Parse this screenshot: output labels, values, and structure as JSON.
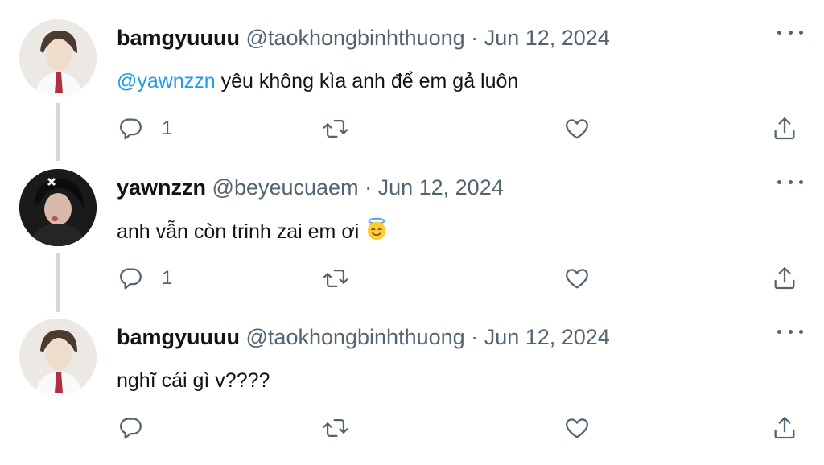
{
  "tweets": [
    {
      "name": "bamgyuuuu",
      "handle": "@taokhongbinhthuong",
      "separator": "·",
      "date": "Jun 12, 2024",
      "mention": "@yawnzzn",
      "text": " yêu không kìa anh để em gả luôn",
      "reply_count": "1",
      "avatar_style": "light"
    },
    {
      "name": "yawnzzn",
      "handle": "@beyeucuaem",
      "separator": "·",
      "date": "Jun 12, 2024",
      "mention": "",
      "text": "anh vẫn còn trinh zai em ơi",
      "emoji": "smiling-face-with-halo",
      "reply_count": "1",
      "avatar_style": "dark"
    },
    {
      "name": "bamgyuuuu",
      "handle": "@taokhongbinhthuong",
      "separator": "·",
      "date": "Jun 12, 2024",
      "mention": "",
      "text": "nghĩ cái gì v????",
      "reply_count": "",
      "avatar_style": "light"
    }
  ],
  "icons": {
    "reply": "reply-icon",
    "retweet": "retweet-icon",
    "like": "heart-icon",
    "share": "share-icon",
    "more": "more-icon"
  },
  "colors": {
    "text": "#0f1419",
    "secondary": "#536471",
    "link": "#1d9bf0",
    "thread_line": "#cfd9de"
  }
}
